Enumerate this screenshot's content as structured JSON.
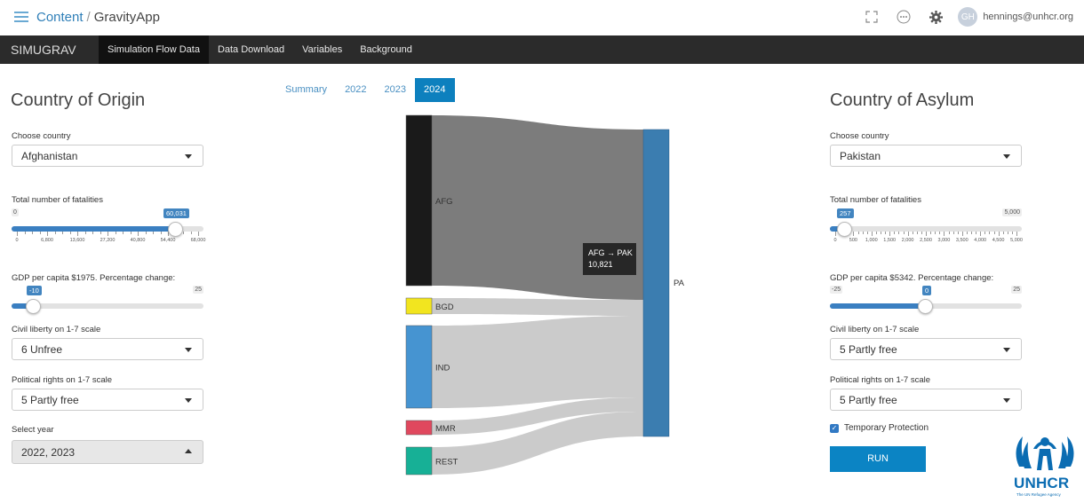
{
  "breadcrumb": {
    "section": "Content",
    "separator": "/",
    "app": "GravityApp"
  },
  "user": {
    "initials": "GH",
    "email": "hennings@unhcr.org"
  },
  "navbar": {
    "brand": "SIMUGRAV",
    "items": [
      "Simulation Flow Data",
      "Data Download",
      "Variables",
      "Background"
    ],
    "active": "Simulation Flow Data"
  },
  "tabs": {
    "items": [
      "Summary",
      "2022",
      "2023",
      "2024"
    ],
    "active": "2024"
  },
  "origin": {
    "title": "Country of Origin",
    "country_label": "Choose country",
    "country": "Afghanistan",
    "fatalities_label": "Total number of fatalities",
    "fatalities": {
      "min": "0",
      "max": "68,000",
      "value": "60,031",
      "value_num": 60031,
      "max_num": 68000,
      "tick_labels": [
        "0",
        "6,800",
        "13,600",
        "27,200",
        "40,800",
        "54,400",
        "68,000"
      ]
    },
    "gdp_label": "GDP per capita $1975. Percentage change:",
    "gdp": {
      "min": "-10",
      "max": "25",
      "value": "-10"
    },
    "civil_label": "Civil liberty on 1-7 scale",
    "civil": "6 Unfree",
    "political_label": "Political rights on 1-7 scale",
    "political": "5 Partly free",
    "year_label": "Select year",
    "year": "2022, 2023"
  },
  "asylum": {
    "title": "Country of Asylum",
    "country_label": "Choose country",
    "country": "Pakistan",
    "fatalities_label": "Total number of fatalities",
    "fatalities": {
      "min": "0",
      "max": "5,000",
      "value": "257",
      "value_num": 257,
      "max_num": 5000,
      "tick_labels": [
        "0",
        "500",
        "1,000",
        "1,500",
        "2,000",
        "2,500",
        "3,000",
        "3,500",
        "4,000",
        "4,500",
        "5,000"
      ]
    },
    "gdp_label": "GDP per capita $5342. Percentage change:",
    "gdp": {
      "min": "-25",
      "max": "25",
      "value": "0"
    },
    "civil_label": "Civil liberty on 1-7 scale",
    "civil": "5 Partly free",
    "political_label": "Political rights on 1-7 scale",
    "political": "5 Partly free",
    "temp_protection_label": "Temporary Protection",
    "temp_protection": true,
    "run_label": "RUN"
  },
  "chart_data": {
    "type": "sankey",
    "sources": [
      {
        "name": "AFG",
        "color": "#1a1a1a"
      },
      {
        "name": "BGD",
        "color": "#f2e51f"
      },
      {
        "name": "IND",
        "color": "#4694d1"
      },
      {
        "name": "MMR",
        "color": "#e0485e"
      },
      {
        "name": "REST",
        "color": "#17b096"
      }
    ],
    "target": {
      "name": "PAK",
      "color": "#3b7db0"
    },
    "tooltip": {
      "flow": "AFG → PAK",
      "value": "10,821"
    }
  },
  "logo": {
    "name": "UNHCR",
    "tagline": "The UN Refugee Agency"
  }
}
